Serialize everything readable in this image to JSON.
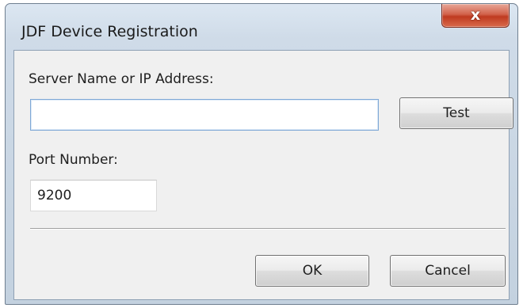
{
  "window": {
    "title": "JDF Device Registration",
    "close_glyph": "x"
  },
  "form": {
    "server": {
      "label": "Server Name or IP Address:",
      "value": "",
      "placeholder": ""
    },
    "port": {
      "label": "Port Number:",
      "value": "9200"
    }
  },
  "buttons": {
    "test_label": "Test",
    "ok_label": "OK",
    "cancel_label": "Cancel"
  },
  "colors": {
    "close_button": "#c74a31",
    "focus_border": "#7fa8d6",
    "dialog_background": "#f0f0f0"
  },
  "icons": {
    "close": "close-icon"
  }
}
